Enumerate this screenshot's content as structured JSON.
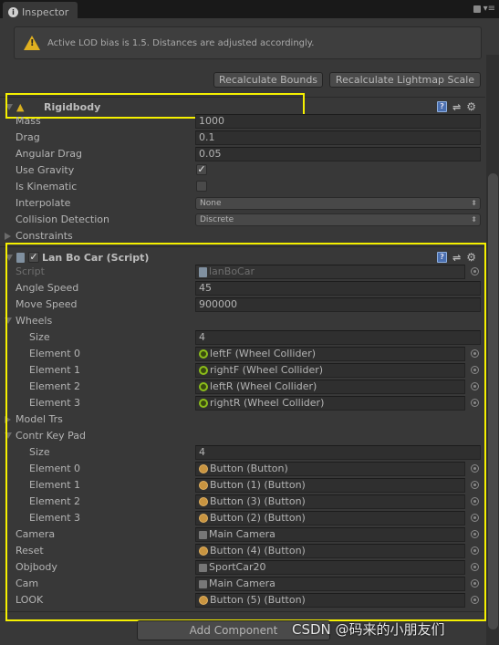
{
  "window": {
    "tab_label": "Inspector",
    "tab_icon": "info-icon"
  },
  "help_box": {
    "icon": "warning-icon",
    "message": "Active LOD bias is 1.5. Distances are adjusted accordingly."
  },
  "buttons": {
    "recalc_bounds": "Recalculate Bounds",
    "recalc_lightmap": "Recalculate Lightmap Scale",
    "add_component": "Add Component"
  },
  "rigidbody": {
    "title": "Rigidbody",
    "expanded": true,
    "rows": [
      {
        "label": "Mass",
        "type": "text",
        "value": "1000"
      },
      {
        "label": "Drag",
        "type": "text",
        "value": "0.1"
      },
      {
        "label": "Angular Drag",
        "type": "text",
        "value": "0.05"
      },
      {
        "label": "Use Gravity",
        "type": "checkbox",
        "checked": true
      },
      {
        "label": "Is Kinematic",
        "type": "checkbox",
        "checked": false
      },
      {
        "label": "Interpolate",
        "type": "dropdown",
        "value": "None"
      },
      {
        "label": "Collision Detection",
        "type": "dropdown",
        "value": "Discrete"
      },
      {
        "label": "Constraints",
        "type": "foldout",
        "expanded": false
      }
    ]
  },
  "script_component": {
    "title": "Lan Bo Car (Script)",
    "enabled": true,
    "rows": [
      {
        "label": "Script",
        "type": "object",
        "value": "lanBoCar",
        "icon": "cs",
        "disabled": true
      },
      {
        "label": "Angle Speed",
        "type": "text",
        "value": "45"
      },
      {
        "label": "Move Speed",
        "type": "text",
        "value": "900000"
      },
      {
        "label": "Wheels",
        "type": "foldout",
        "expanded": true
      },
      {
        "label": "Size",
        "type": "text",
        "value": "4",
        "indent": 1
      },
      {
        "label": "Element 0",
        "type": "object",
        "value": "leftF (Wheel Collider)",
        "icon": "wheel",
        "indent": 1
      },
      {
        "label": "Element 1",
        "type": "object",
        "value": "rightF (Wheel Collider)",
        "icon": "wheel",
        "indent": 1
      },
      {
        "label": "Element 2",
        "type": "object",
        "value": "leftR (Wheel Collider)",
        "icon": "wheel",
        "indent": 1
      },
      {
        "label": "Element 3",
        "type": "object",
        "value": "rightR (Wheel Collider)",
        "icon": "wheel",
        "indent": 1
      },
      {
        "label": "Model Trs",
        "type": "foldout",
        "expanded": false
      },
      {
        "label": "Contr Key Pad",
        "type": "foldout",
        "expanded": true
      },
      {
        "label": "Size",
        "type": "text",
        "value": "4",
        "indent": 1
      },
      {
        "label": "Element 0",
        "type": "object",
        "value": "Button (Button)",
        "icon": "btn",
        "indent": 1
      },
      {
        "label": "Element 1",
        "type": "object",
        "value": "Button (1) (Button)",
        "icon": "btn",
        "indent": 1
      },
      {
        "label": "Element 2",
        "type": "object",
        "value": "Button (3) (Button)",
        "icon": "btn",
        "indent": 1
      },
      {
        "label": "Element 3",
        "type": "object",
        "value": "Button (2) (Button)",
        "icon": "btn",
        "indent": 1
      },
      {
        "label": "Camera",
        "type": "object",
        "value": "Main Camera",
        "icon": "cube"
      },
      {
        "label": "Reset",
        "type": "object",
        "value": "Button (4) (Button)",
        "icon": "btn"
      },
      {
        "label": "Objbody",
        "type": "object",
        "value": "SportCar20",
        "icon": "cube"
      },
      {
        "label": "Cam",
        "type": "object",
        "value": "Main Camera",
        "icon": "cube"
      },
      {
        "label": "LOOK",
        "type": "object",
        "value": "Button (5) (Button)",
        "icon": "btn"
      }
    ]
  },
  "watermark": "CSDN @码来的小朋友们",
  "colors": {
    "highlight": "#f5f000",
    "panel": "#383838",
    "warning": "#e0b020"
  }
}
